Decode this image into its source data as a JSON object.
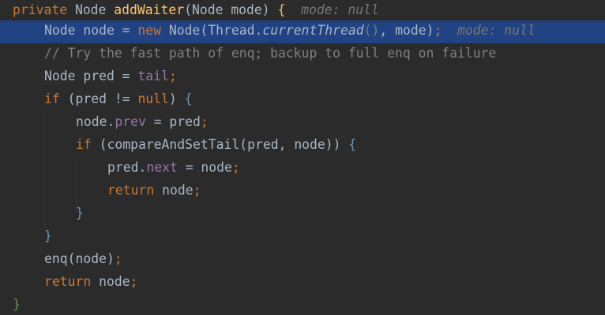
{
  "editor": {
    "theme": "dark",
    "background": "#2b2b2b",
    "current_line_background": "#214283",
    "lines": [
      {
        "tokens": [
          {
            "t": "private",
            "k": "keyword"
          },
          {
            "t": " Node ",
            "k": "plain"
          },
          {
            "t": "addWaiter",
            "k": "method-declaration"
          },
          {
            "t": "(Node mode) ",
            "k": "plain"
          },
          {
            "t": "{",
            "k": "brace-yellow"
          },
          {
            "t": "  mode: null",
            "k": "inlay-hint"
          }
        ]
      },
      {
        "current": true,
        "tokens": [
          {
            "t": "Node node = ",
            "k": "plain"
          },
          {
            "t": "new",
            "k": "keyword"
          },
          {
            "t": " Node(Thread.",
            "k": "plain"
          },
          {
            "t": "currentThread",
            "k": "static-method"
          },
          {
            "t": "()",
            "k": "brace-green"
          },
          {
            "t": ", mode)",
            "k": "plain"
          },
          {
            "t": ";",
            "k": "keyword"
          },
          {
            "t": "  mode: null",
            "k": "inlay-hint"
          }
        ]
      },
      {
        "tokens": [
          {
            "t": "// Try the fast path of enq; backup to full enq on failure",
            "k": "comment"
          }
        ]
      },
      {
        "tokens": [
          {
            "t": "Node pred = ",
            "k": "plain"
          },
          {
            "t": "tail",
            "k": "field"
          },
          {
            "t": ";",
            "k": "keyword"
          }
        ]
      },
      {
        "tokens": [
          {
            "t": "if",
            "k": "keyword"
          },
          {
            "t": " (pred != ",
            "k": "plain"
          },
          {
            "t": "null",
            "k": "keyword"
          },
          {
            "t": ") ",
            "k": "plain"
          },
          {
            "t": "{",
            "k": "brace-blue"
          }
        ]
      },
      {
        "tokens": [
          {
            "t": "node.",
            "k": "plain"
          },
          {
            "t": "prev",
            "k": "field"
          },
          {
            "t": " = pred",
            "k": "plain"
          },
          {
            "t": ";",
            "k": "keyword"
          }
        ]
      },
      {
        "tokens": [
          {
            "t": "if",
            "k": "keyword"
          },
          {
            "t": " (compareAndSetTail(pred, node)) ",
            "k": "plain"
          },
          {
            "t": "{",
            "k": "brace-blue"
          }
        ]
      },
      {
        "tokens": [
          {
            "t": "pred.",
            "k": "plain"
          },
          {
            "t": "next",
            "k": "field"
          },
          {
            "t": " = node",
            "k": "plain"
          },
          {
            "t": ";",
            "k": "keyword"
          }
        ]
      },
      {
        "tokens": [
          {
            "t": "return",
            "k": "keyword"
          },
          {
            "t": " node",
            "k": "plain"
          },
          {
            "t": ";",
            "k": "keyword"
          }
        ]
      },
      {
        "tokens": [
          {
            "t": "}",
            "k": "brace-blue"
          }
        ]
      },
      {
        "tokens": [
          {
            "t": "}",
            "k": "brace-blue"
          }
        ]
      },
      {
        "tokens": [
          {
            "t": "enq(node)",
            "k": "plain"
          },
          {
            "t": ";",
            "k": "keyword"
          }
        ]
      },
      {
        "tokens": [
          {
            "t": "return",
            "k": "keyword"
          },
          {
            "t": " node",
            "k": "plain"
          },
          {
            "t": ";",
            "k": "keyword"
          }
        ]
      },
      {
        "tokens": [
          {
            "t": "}",
            "k": "brace-green"
          }
        ]
      }
    ]
  }
}
